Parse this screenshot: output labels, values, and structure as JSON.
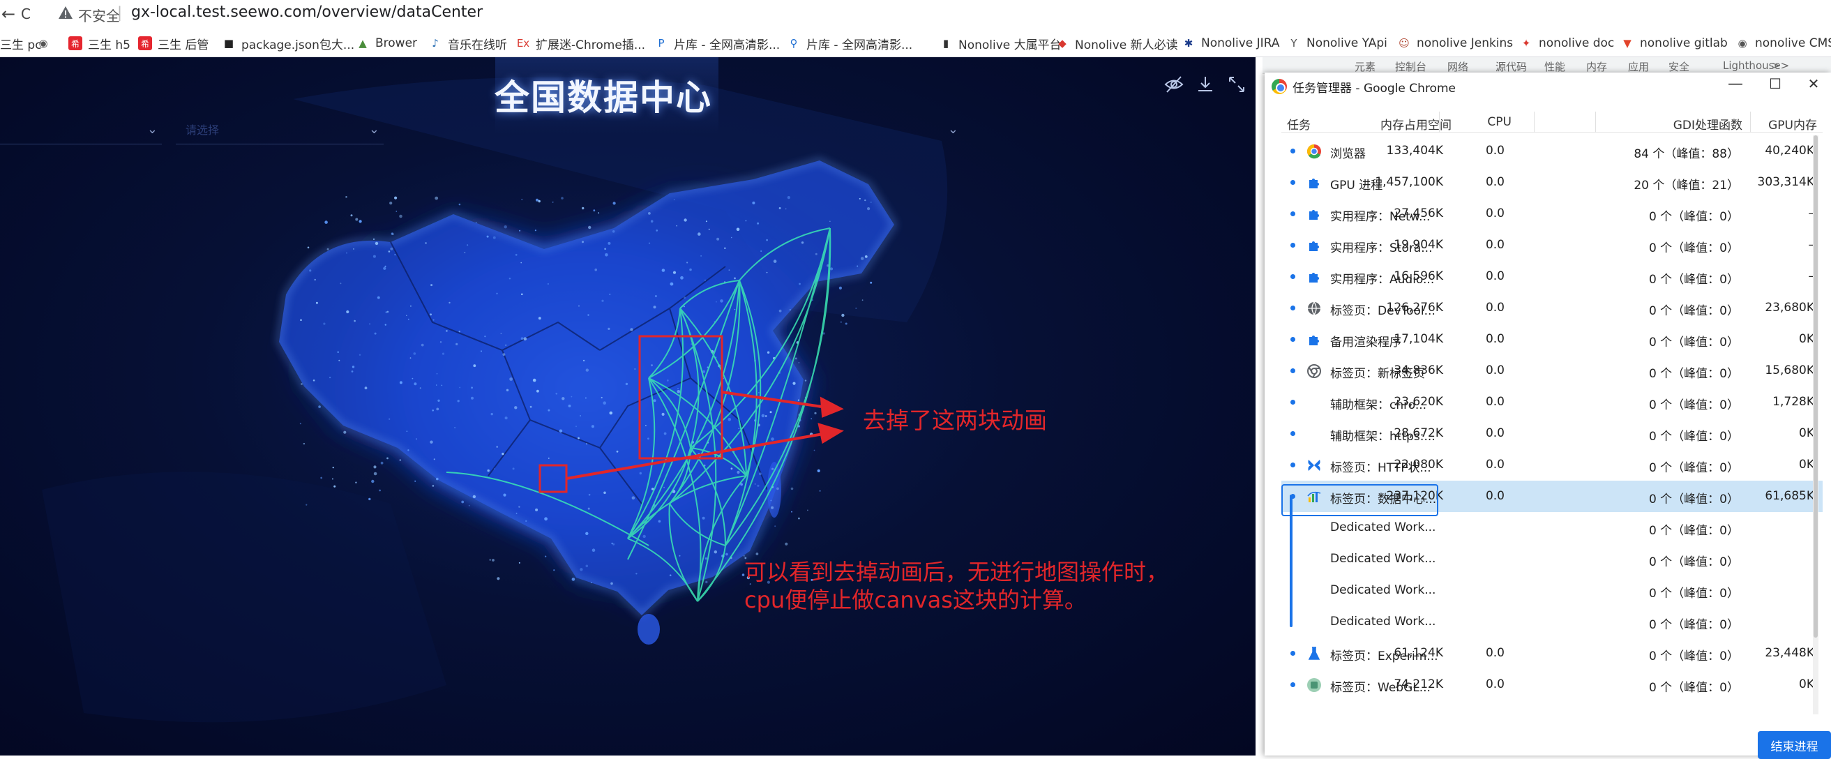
{
  "browser": {
    "security_label": "不安全",
    "separator": "|",
    "url": "gx-local.test.seewo.com/overview/dataCenter",
    "back_glyph": "←",
    "reload_glyph": "C"
  },
  "bookmarks": [
    {
      "label": "三生 pc",
      "icon": "seewo-icon",
      "color": "#444444"
    },
    {
      "label": "",
      "icon": "globe-icon",
      "color": "#555555"
    },
    {
      "label": "三生 h5",
      "icon": "seewo-badge-icon",
      "color": "#e5262f"
    },
    {
      "label": "三生 后管",
      "icon": "seewo-badge-icon",
      "color": "#e5262f"
    },
    {
      "label": "package.json包大...",
      "icon": "box-icon",
      "color": "#222222"
    },
    {
      "label": "Brower",
      "icon": "picture-icon",
      "color": "#4a8d3a"
    },
    {
      "label": "音乐在线听",
      "icon": "music-icon",
      "color": "#2a6fb4"
    },
    {
      "label": "扩展迷-Chrome插...",
      "icon": "ex-icon",
      "color": "#d9382f"
    },
    {
      "label": "片库 - 全网高清影...",
      "icon": "p-icon",
      "color": "#1e6ed2"
    },
    {
      "label": "片库 - 全网高清影...",
      "icon": "search-icon",
      "color": "#1e6ed2"
    },
    {
      "label": "Nonolive 大属平台",
      "icon": "flag-icon",
      "color": "#333333"
    },
    {
      "label": "Nonolive 新人必读",
      "icon": "diamond-icon",
      "color": "#d9382f"
    },
    {
      "label": "Nonolive JIRA",
      "icon": "jira-icon",
      "color": "#1a3a8a"
    },
    {
      "label": "Nonolive YApi",
      "icon": "yapi-icon",
      "color": "#555555"
    },
    {
      "label": "nonolive Jenkins",
      "icon": "jenkins-icon",
      "color": "#b14b36"
    },
    {
      "label": "nonolive doc",
      "icon": "doc-icon",
      "color": "#d9382f"
    },
    {
      "label": "nonolive gitlab",
      "icon": "gitlab-icon",
      "color": "#e2432a"
    },
    {
      "label": "nonolive CMS",
      "icon": "globe-icon",
      "color": "#555555"
    }
  ],
  "dashboard": {
    "title": "全国数据中心",
    "dropdown_placeholder": "请选择",
    "tool_icons": [
      "eye-off-icon",
      "download-icon",
      "fullscreen-icon"
    ]
  },
  "annotations": {
    "note1": "去掉了这两块动画",
    "note2_line1": "可以看到去掉动画后，无进行地图操作时，",
    "note2_line2": "cpu便停止做canvas这块的计算。",
    "color": "#e2262a"
  },
  "devtools_tabs": [
    "元素",
    "控制台",
    "网络",
    "源代码",
    "性能",
    "内存",
    "应用",
    "安全",
    "Lighthouse",
    ">>"
  ],
  "task_manager": {
    "title": "任务管理器 - Google Chrome",
    "window_buttons": [
      "—",
      "☐",
      "✕"
    ],
    "columns": {
      "task": "任务",
      "memory": "内存占用空间",
      "cpu": "CPU",
      "gdi": "GDI处理函数",
      "gpu": "GPU内存"
    },
    "rows": [
      {
        "icon": "chrome-icon",
        "name": "浏览器",
        "memory": "133,404K",
        "cpu": "0.0",
        "gdi": "84 个（峰值：88）",
        "gpu": "40,240K"
      },
      {
        "icon": "puzzle-icon",
        "name": "GPU 进程",
        "memory": "1,457,100K",
        "cpu": "0.0",
        "gdi": "20 个（峰值：21）",
        "gpu": "303,314K"
      },
      {
        "icon": "puzzle-icon",
        "name": "实用程序：Netw...",
        "memory": "27,456K",
        "cpu": "0.0",
        "gdi": "0 个（峰值：0）",
        "gpu": "–"
      },
      {
        "icon": "puzzle-icon",
        "name": "实用程序：Stora...",
        "memory": "19,904K",
        "cpu": "0.0",
        "gdi": "0 个（峰值：0）",
        "gpu": "–"
      },
      {
        "icon": "puzzle-icon",
        "name": "实用程序：Audio...",
        "memory": "16,596K",
        "cpu": "0.0",
        "gdi": "0 个（峰值：0）",
        "gpu": "–"
      },
      {
        "icon": "globe-icon",
        "name": "标签页：DevTool...",
        "memory": "126,276K",
        "cpu": "0.0",
        "gdi": "0 个（峰值：0）",
        "gpu": "23,680K"
      },
      {
        "icon": "puzzle-icon",
        "name": "备用渲染程序",
        "memory": "17,104K",
        "cpu": "0.0",
        "gdi": "0 个（峰值：0）",
        "gpu": "0K"
      },
      {
        "icon": "chrome-gray-icon",
        "name": "标签页：新标签页",
        "memory": "34,836K",
        "cpu": "0.0",
        "gdi": "0 个（峰值：0）",
        "gpu": "15,680K"
      },
      {
        "icon": "",
        "name": "辅助框架：chro...",
        "memory": "23,620K",
        "cpu": "0.0",
        "gdi": "0 个（峰值：0）",
        "gpu": "1,728K"
      },
      {
        "icon": "",
        "name": "辅助框架：https:...",
        "memory": "28,672K",
        "cpu": "0.0",
        "gdi": "0 个（峰值：0）",
        "gpu": "0K"
      },
      {
        "icon": "butterfly-icon",
        "name": "标签页：HTTP状...",
        "memory": "22,080K",
        "cpu": "0.0",
        "gdi": "0 个（峰值：0）",
        "gpu": "0K"
      },
      {
        "icon": "chart-icon",
        "name": "标签页：数据中心...",
        "memory": "237,120K",
        "cpu": "0.0",
        "gdi": "0 个（峰值：0）",
        "gpu": "61,685K",
        "selected": true
      },
      {
        "icon": "",
        "name": "Dedicated Work...",
        "memory": "",
        "cpu": "",
        "gdi": "0 个（峰值：0）",
        "gpu": ""
      },
      {
        "icon": "",
        "name": "Dedicated Work...",
        "memory": "",
        "cpu": "",
        "gdi": "0 个（峰值：0）",
        "gpu": ""
      },
      {
        "icon": "",
        "name": "Dedicated Work...",
        "memory": "",
        "cpu": "",
        "gdi": "0 个（峰值：0）",
        "gpu": ""
      },
      {
        "icon": "",
        "name": "Dedicated Work...",
        "memory": "",
        "cpu": "",
        "gdi": "0 个（峰值：0）",
        "gpu": ""
      },
      {
        "icon": "flask-icon",
        "name": "标签页：Experim...",
        "memory": "61,124K",
        "cpu": "0.0",
        "gdi": "0 个（峰值：0）",
        "gpu": "23,448K"
      },
      {
        "icon": "webgl-icon",
        "name": "标签页：WebGL...",
        "memory": "74,212K",
        "cpu": "0.0",
        "gdi": "0 个（峰值：0）",
        "gpu": "0K"
      }
    ],
    "end_button": "结束进程"
  }
}
